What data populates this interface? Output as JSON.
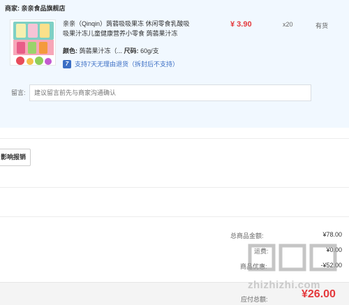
{
  "shop": {
    "label": "商家:",
    "name": "亲亲食品旗舰店"
  },
  "item": {
    "title": "亲亲（Qinqin）蒟蒻吸吸果冻 休闲零食乳酸吸吸果汁冻儿童健康营养小零食 蒟蒻果汁冻",
    "color_key": "颜色:",
    "color_val": "蒟蒻果汁冻（...",
    "size_key": "尺码:",
    "size_val": "60g/支",
    "service_badge": "7",
    "service_text": "支持7天无理由退货（拆封后不支持）",
    "price": "¥ 3.90",
    "qty": "x20",
    "stock": "有货"
  },
  "message": {
    "label": "留言:",
    "placeholder": "建议留言前先与商家沟通确认"
  },
  "invoice": {
    "button_label": "影响报销"
  },
  "summary": {
    "goods_total_label": "总商品金额:",
    "goods_total_value": "¥78.00",
    "shipping_label": "运费:",
    "shipping_value": "¥0.00",
    "discount_label": "商品优惠:",
    "discount_value": "-¥52.00"
  },
  "footer": {
    "pay_label": "应付总额:",
    "pay_amount": "¥26.00"
  },
  "watermark": {
    "text": "zhizhizhi.com"
  },
  "colors": {
    "accent_red": "#e4393c",
    "service_blue": "#3b6ec4",
    "panel_bg": "#f1f8ff"
  }
}
